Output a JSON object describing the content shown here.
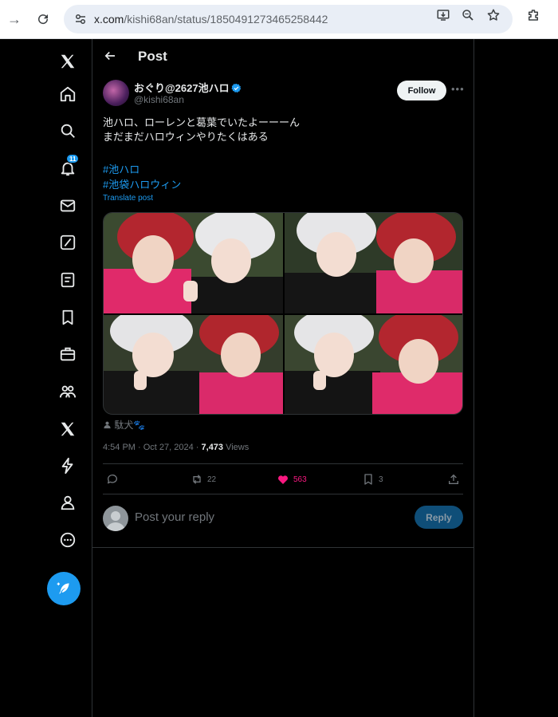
{
  "browser": {
    "url_host": "x.com",
    "url_path": "/kishi68an/status/1850491273465258442"
  },
  "nav": {
    "notifications_badge": "11"
  },
  "header": {
    "title": "Post"
  },
  "post": {
    "author_name": "おぐり@2627池ハロ",
    "author_handle": "@kishi68an",
    "follow_label": "Follow",
    "text": "池ハロ、ローレンと葛葉でいたよーーーん\nまだまだハロウィンやりたくはある",
    "hashtags": [
      "#池ハロ",
      "#池袋ハロウィン"
    ],
    "translate_label": "Translate post",
    "photo_credit": "駄犬🐾",
    "timestamp": "4:54 PM · Oct 27, 2024 · ",
    "views_count": "7,473",
    "views_label": " Views",
    "retweets": "22",
    "likes": "563",
    "bookmarks": "3"
  },
  "reply": {
    "placeholder": "Post your reply",
    "button_label": "Reply"
  },
  "colors": {
    "accent": "#1d9bf0",
    "like": "#f91880",
    "background": "#000000"
  }
}
